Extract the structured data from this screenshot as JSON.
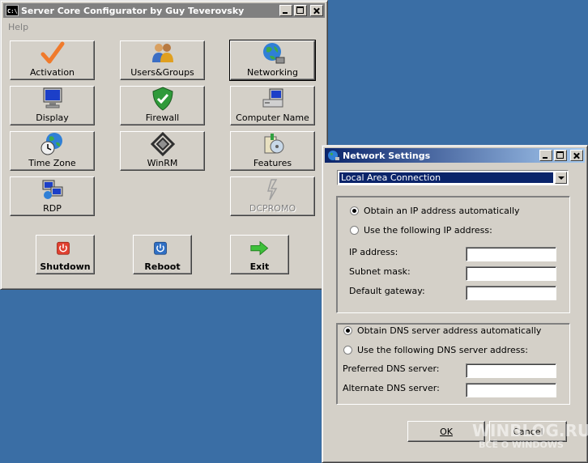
{
  "main_window": {
    "title": "Server Core Configurator by Guy Teverovsky",
    "menu": [
      "Help"
    ],
    "buttons": {
      "activation": "Activation",
      "users_groups": "Users&Groups",
      "networking": "Networking",
      "display": "Display",
      "firewall": "Firewall",
      "computer_name": "Computer Name",
      "time_zone": "Time Zone",
      "winrm": "WinRM",
      "features": "Features",
      "rdp": "RDP",
      "dcpromo": "DCPROMO",
      "shutdown": "Shutdown",
      "reboot": "Reboot",
      "exit": "Exit"
    }
  },
  "network_dialog": {
    "title": "Network Settings",
    "adapter": "Local Area Connection",
    "ip_auto": "Obtain an IP address automatically",
    "ip_manual": "Use the following IP address:",
    "ip_label": "IP address:",
    "subnet_label": "Subnet mask:",
    "gateway_label": "Default gateway:",
    "ip_value": "",
    "subnet_value": "",
    "gateway_value": "",
    "dns_auto": "Obtain DNS server address automatically",
    "dns_manual": "Use the following DNS server address:",
    "preferred_label": "Preferred DNS server:",
    "alternate_label": "Alternate DNS server:",
    "preferred_value": "",
    "alternate_value": "",
    "ok": "OK",
    "cancel": "Cancel"
  },
  "watermark": {
    "line1": "WINBLOG.RU",
    "line2": "ВСЁ О WINDOWS"
  }
}
